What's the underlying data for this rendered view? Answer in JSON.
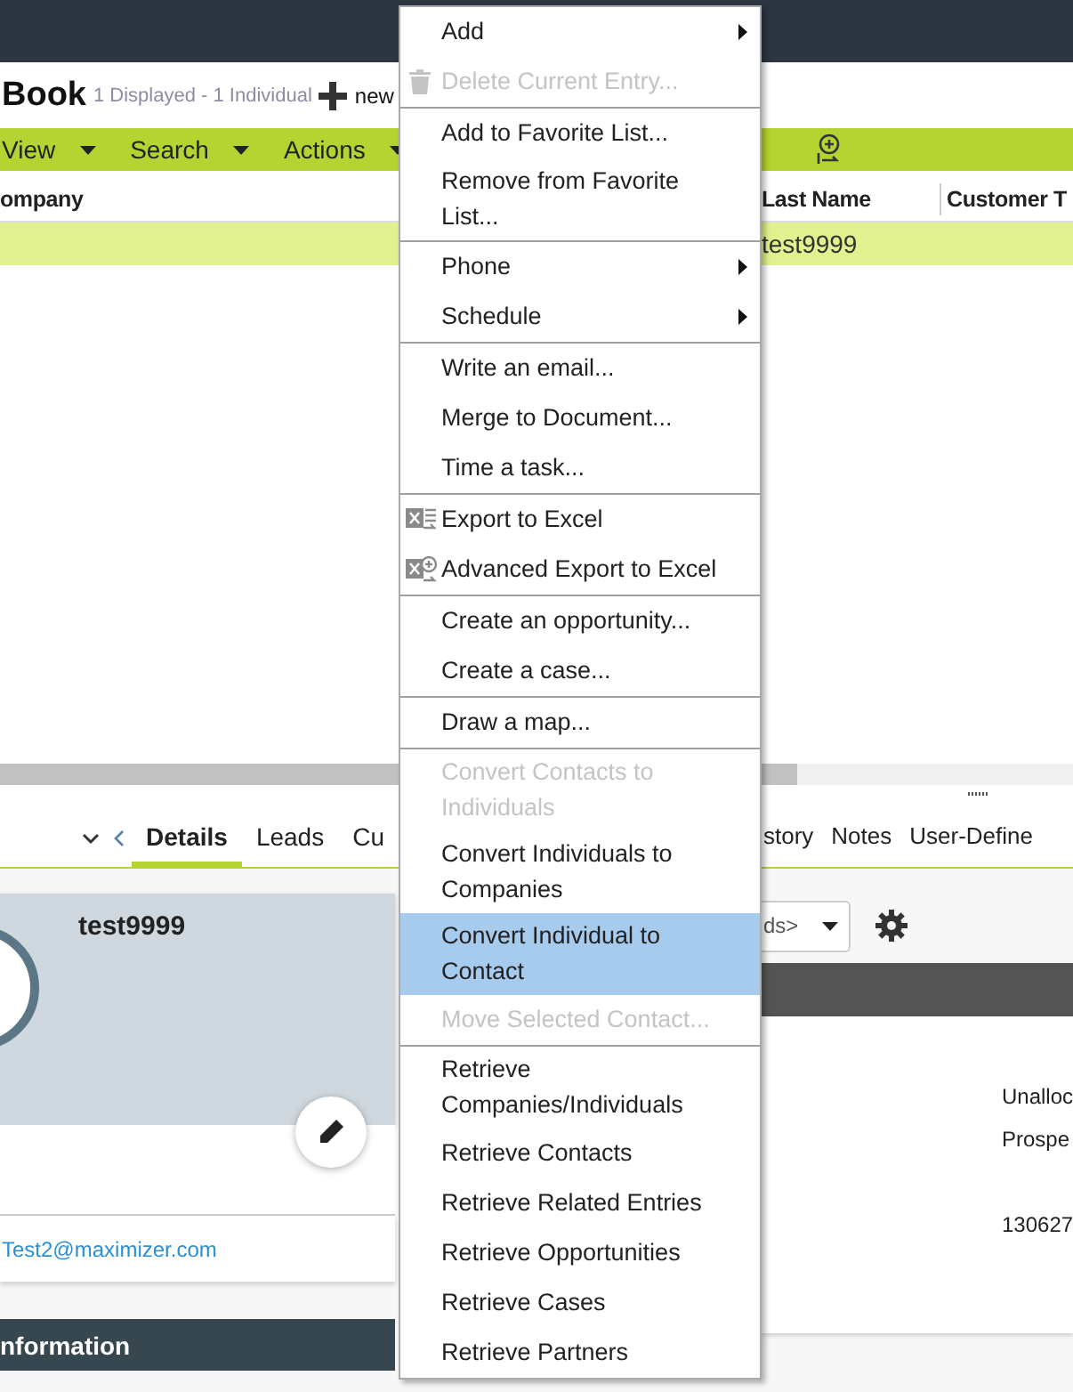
{
  "header": {
    "title": "Book",
    "summary": "1 Displayed - 1 Individual",
    "new_label": "new"
  },
  "toolbar": [
    {
      "label": "View"
    },
    {
      "label": "Search"
    },
    {
      "label": "Actions"
    }
  ],
  "table": {
    "columns": [
      "ompany",
      "Last Name",
      "Customer T"
    ],
    "rows": [
      {
        "last_name": "test9999",
        "selected": true
      }
    ]
  },
  "tabs": [
    {
      "label": "Details",
      "selected": true
    },
    {
      "label": "Leads",
      "selected": false
    },
    {
      "label": "Cu",
      "selected": false
    },
    {
      "label": "story",
      "selected": false
    },
    {
      "label": "Notes",
      "selected": false
    },
    {
      "label": "User-Define",
      "selected": false
    }
  ],
  "card": {
    "name": "test9999",
    "email": "Test2@maximizer.com",
    "section": "nformation"
  },
  "right_panel": {
    "dropdown": "ds>",
    "values": [
      "Unalloc",
      "Prospe",
      "130627"
    ]
  },
  "menu": {
    "groups": [
      [
        {
          "label": "Add",
          "kind": "submenu",
          "disabled": false,
          "selected": false
        },
        {
          "label": "Delete Current Entry...",
          "kind": "delete",
          "disabled": true,
          "selected": false
        }
      ],
      [
        {
          "label": "Add to Favorite List...",
          "kind": "plain",
          "disabled": false,
          "selected": false
        },
        {
          "label": "Remove from Favorite List...",
          "kind": "plain",
          "disabled": false,
          "selected": false
        }
      ],
      [
        {
          "label": "Phone",
          "kind": "submenu",
          "disabled": false,
          "selected": false
        },
        {
          "label": "Schedule",
          "kind": "submenu",
          "disabled": false,
          "selected": false
        }
      ],
      [
        {
          "label": "Write an email...",
          "kind": "plain",
          "disabled": false,
          "selected": false
        },
        {
          "label": "Merge to Document...",
          "kind": "plain",
          "disabled": false,
          "selected": false
        },
        {
          "label": "Time a task...",
          "kind": "plain",
          "disabled": false,
          "selected": false
        }
      ],
      [
        {
          "label": "Export to Excel",
          "kind": "export",
          "disabled": false,
          "selected": false
        },
        {
          "label": "Advanced Export to Excel",
          "kind": "advanced-export",
          "disabled": false,
          "selected": false
        }
      ],
      [
        {
          "label": "Create an opportunity...",
          "kind": "plain",
          "disabled": false,
          "selected": false
        },
        {
          "label": "Create a case...",
          "kind": "plain",
          "disabled": false,
          "selected": false
        }
      ],
      [
        {
          "label": "Draw a map...",
          "kind": "plain",
          "disabled": false,
          "selected": false
        }
      ],
      [
        {
          "label": "Convert Contacts to Individuals",
          "kind": "plain",
          "disabled": true,
          "selected": false
        },
        {
          "label": "Convert Individuals to Companies",
          "kind": "plain",
          "disabled": false,
          "selected": false
        },
        {
          "label": "Convert Individual to Contact",
          "kind": "plain",
          "disabled": false,
          "selected": true
        },
        {
          "label": "Move Selected Contact...",
          "kind": "plain",
          "disabled": true,
          "selected": false
        }
      ],
      [
        {
          "label": "Retrieve Companies/Individuals",
          "kind": "plain",
          "disabled": false,
          "selected": false
        },
        {
          "label": "Retrieve Contacts",
          "kind": "plain",
          "disabled": false,
          "selected": false
        },
        {
          "label": "Retrieve Related Entries",
          "kind": "plain",
          "disabled": false,
          "selected": false
        },
        {
          "label": "Retrieve Opportunities",
          "kind": "plain",
          "disabled": false,
          "selected": false
        },
        {
          "label": "Retrieve Cases",
          "kind": "plain",
          "disabled": false,
          "selected": false
        },
        {
          "label": "Retrieve Partners",
          "kind": "plain",
          "disabled": false,
          "selected": false
        }
      ]
    ]
  }
}
